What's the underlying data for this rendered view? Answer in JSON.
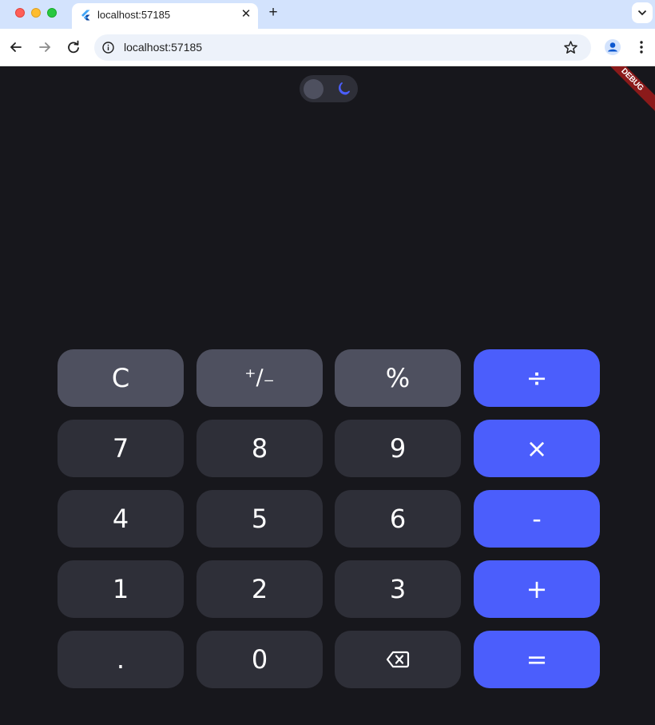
{
  "browser": {
    "tab_title": "localhost:57185",
    "tab_close": "✕",
    "new_tab": "+",
    "url": "localhost:57185"
  },
  "app": {
    "debug_label": "DEBUG",
    "theme_mode": "dark",
    "colors": {
      "background": "#17171c",
      "number_key": "#2e2f38",
      "function_key": "#4e505f",
      "operator_key": "#4b5efc"
    },
    "keys": {
      "clear": "C",
      "plus_minus": "⁺∕₋",
      "percent": "%",
      "divide": "÷",
      "seven": "7",
      "eight": "8",
      "nine": "9",
      "multiply": "×",
      "four": "4",
      "five": "5",
      "six": "6",
      "minus": "-",
      "one": "1",
      "two": "2",
      "three": "3",
      "plus": "+",
      "decimal": ".",
      "zero": "0",
      "backspace_icon": "backspace-icon",
      "equals": "="
    }
  }
}
